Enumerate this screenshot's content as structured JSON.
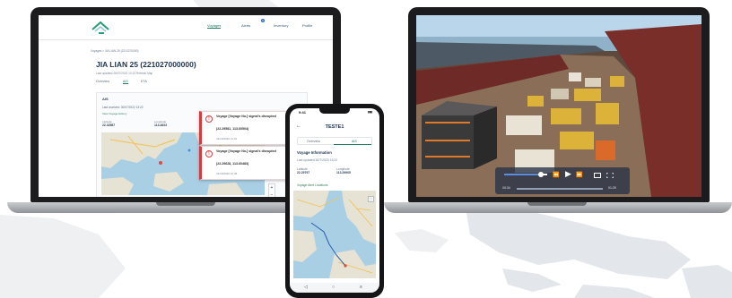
{
  "left_laptop": {
    "nav": {
      "voyages": "Voyages",
      "alerts": "Alerts",
      "alerts_badge": "3",
      "inventory": "Inventory",
      "profile": "Profile"
    },
    "breadcrumb": "Voyages  >  JIA LIAN 25 (2210270000)",
    "vessel_title": "JIA LIAN 25 (221027000000)",
    "last_updated": "Last updated 26/07/2022 13:22 Refresh Map",
    "tabs": {
      "overview": "Overview",
      "ais": "AIS",
      "eta": "ETA"
    },
    "ais_card": {
      "heading": "AIS",
      "subheading": "Last received: 30/07/2022 13:22",
      "link": "View Voyage History",
      "latitude_label": "Latitude",
      "latitude_value": "22.32587",
      "longitude_label": "Longitude",
      "longitude_value": "113.4833"
    },
    "alerts": [
      {
        "title": "Voyage [Voyage No.] signal's disrupted",
        "coords": "(22.29581, 113.60504)",
        "date": "31/10/2022 11:02"
      },
      {
        "title": "Voyage [Voyage No.] signal's disrupted",
        "coords": "(22.29628, 113.60483)",
        "date": "31/10/2022 10:38"
      }
    ],
    "zoom": {
      "in": "+",
      "out": "−"
    }
  },
  "right_laptop": {
    "video_controls": {
      "rewind": "⏪",
      "play": "▶",
      "forward": "⏩",
      "current": "00:34",
      "duration": "01:25"
    }
  },
  "phone": {
    "status_time": "9:41",
    "status_icons": "▮▮▮",
    "title": "TESTE1",
    "back": "←",
    "tabs": {
      "overview": "Overview",
      "ais": "AIS"
    },
    "section": "Voyage Information",
    "last_updated": "Last updated 30/7/2023 13:22",
    "latitude_label": "Latitude",
    "latitude_value": "22.29797",
    "longitude_label": "Longitude",
    "longitude_value": "113.29905",
    "link": "Voyage Alert Locations",
    "fullscreen": "⛶",
    "navbar": {
      "back": "◁",
      "home": "○",
      "menu": "≡"
    }
  }
}
